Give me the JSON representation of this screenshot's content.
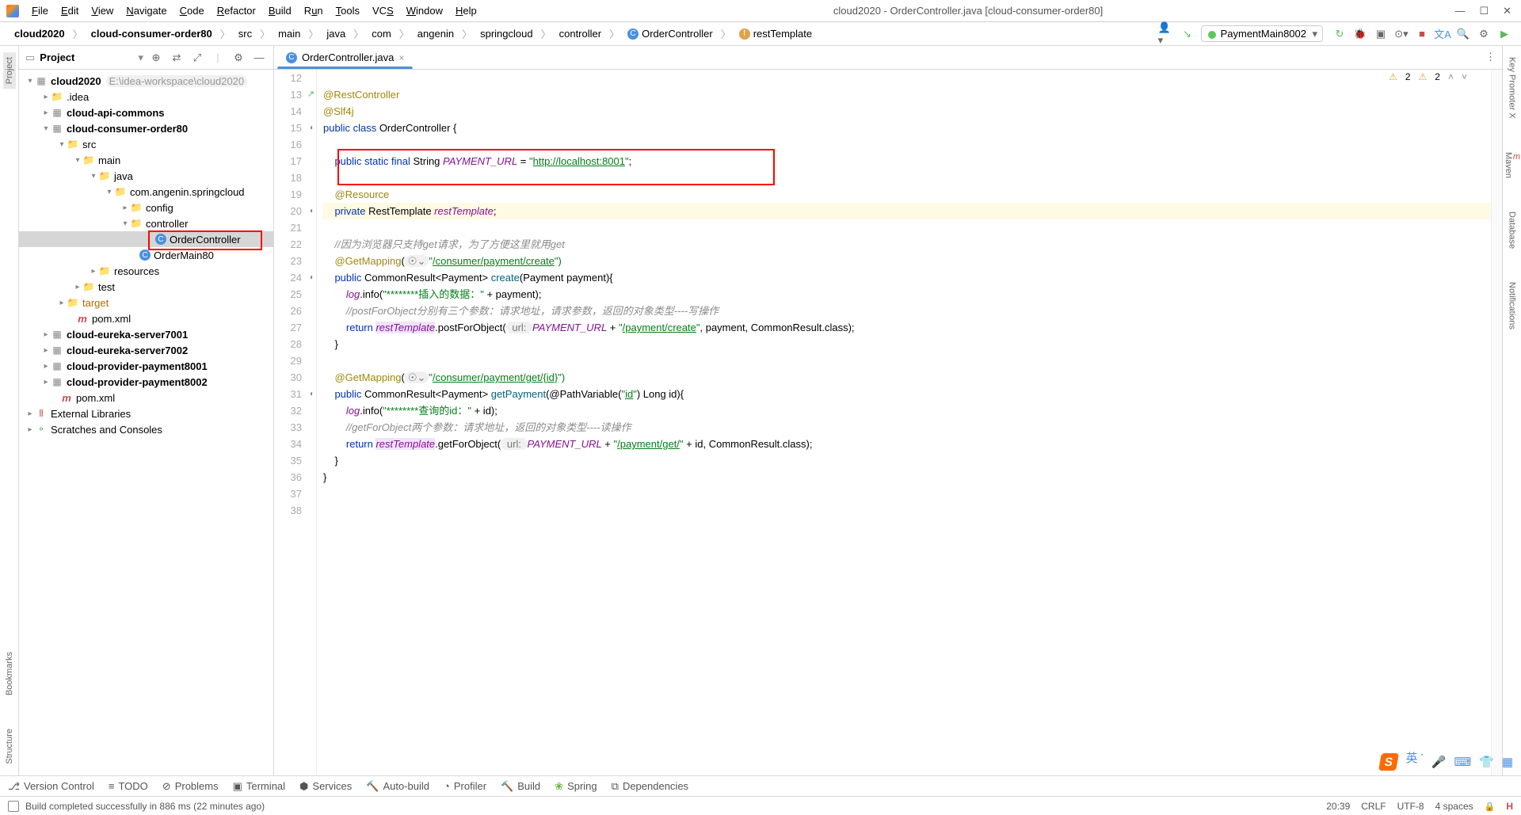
{
  "window": {
    "title": "cloud2020 - OrderController.java [cloud-consumer-order80]"
  },
  "menu": {
    "file": "File",
    "edit": "Edit",
    "view": "View",
    "navigate": "Navigate",
    "code": "Code",
    "refactor": "Refactor",
    "build": "Build",
    "run": "Run",
    "tools": "Tools",
    "vcs": "VCS",
    "window": "Window",
    "help": "Help"
  },
  "breadcrumb": {
    "items": [
      "cloud2020",
      "cloud-consumer-order80",
      "src",
      "main",
      "java",
      "com",
      "angenin",
      "springcloud",
      "controller",
      "OrderController",
      "restTemplate"
    ]
  },
  "runConfig": {
    "name": "PaymentMain8002"
  },
  "leftTabs": {
    "project": "Project",
    "bookmarks": "Bookmarks",
    "structure": "Structure"
  },
  "rightTabs": {
    "keypromoter": "Key Promoter X",
    "maven": "Maven",
    "database": "Database",
    "notifications": "Notifications"
  },
  "projectPanel": {
    "title": "Project",
    "tree": {
      "root": "cloud2020",
      "rootHint": "E:\\idea-workspace\\cloud2020",
      "idea": ".idea",
      "apiCommons": "cloud-api-commons",
      "consumer": "cloud-consumer-order80",
      "src": "src",
      "main": "main",
      "java": "java",
      "pkg": "com.angenin.springcloud",
      "config": "config",
      "controller": "controller",
      "orderController": "OrderController",
      "orderMain": "OrderMain80",
      "resources": "resources",
      "test": "test",
      "target": "target",
      "pom": "pom.xml",
      "eureka1": "cloud-eureka-server7001",
      "eureka2": "cloud-eureka-server7002",
      "payment1": "cloud-provider-payment8001",
      "payment2": "cloud-provider-payment8002",
      "pomRoot": "pom.xml",
      "extLibs": "External Libraries",
      "scratches": "Scratches and Consoles"
    }
  },
  "editor": {
    "tabName": "OrderController.java",
    "warnings": {
      "error": "2",
      "warn": "2"
    },
    "lines": {
      "l12": "",
      "l13": "@RestController",
      "l14": "@Slf4j",
      "l15a": "public class ",
      "l15b": "OrderController {",
      "l16": "",
      "l17a": "    public static final ",
      "l17b": "String ",
      "l17c": "PAYMENT_URL",
      "l17d": " = ",
      "l17e": "\"",
      "l17f": "http://localhost:8001",
      "l17g": "\"",
      "l17h": ";",
      "l18": "",
      "l19": "    @Resource",
      "l20a": "    private ",
      "l20b": "RestTemplate ",
      "l20c": "restTemplate",
      "l20d": ";",
      "l21": "",
      "l22": "    //因为浏览器只支持get请求，为了方便这里就用get",
      "l23a": "    @GetMapping",
      "l23b": "(",
      "l23h": "\"",
      "l23c": "/consumer/payment/create",
      "l23d": "\")",
      "l24a": "    public ",
      "l24b": "CommonResult<Payment> ",
      "l24c": "create",
      "l24d": "(Payment payment){",
      "l25a": "        log",
      "l25b": ".info(",
      "l25c": "\"********插入的数据：\"",
      "l25d": " + payment);",
      "l26": "        //postForObject分别有三个参数：请求地址，请求参数，返回的对象类型----写操作",
      "l27a": "        return ",
      "l27b": "restTemplate",
      "l27c": ".postForObject(",
      "l27h": " url: ",
      "l27d": "PAYMENT_URL",
      "l27e": " + ",
      "l27f": "\"",
      "l27f2": "/payment/create",
      "l27f3": "\"",
      "l27g": ", payment, CommonResult.class);",
      "l28": "    }",
      "l29": "",
      "l30a": "    @GetMapping",
      "l30b": "(",
      "l30h": "\"",
      "l30c": "/consumer/payment/get/{id}",
      "l30d": "\")",
      "l31a": "    public ",
      "l31b": "CommonResult<Payment> ",
      "l31c": "getPayment",
      "l31d": "(@PathVariable(",
      "l31e": "\"",
      "l31e2": "id",
      "l31e3": "\"",
      "l31f": ") Long id){",
      "l32a": "        log",
      "l32b": ".info(",
      "l32c": "\"********查询的id：\"",
      "l32d": " + id);",
      "l33": "        //getForObject两个参数：请求地址，返回的对象类型----读操作",
      "l34a": "        return ",
      "l34b": "restTemplate",
      "l34c": ".getForObject(",
      "l34h": " url: ",
      "l34d": "PAYMENT_URL",
      "l34e": " + ",
      "l34f": "\"",
      "l34f2": "/payment/get/",
      "l34f3": "\"",
      "l34g": " + id, CommonResult.class);",
      "l35": "    }",
      "l36": "}",
      "l37": "",
      "l38": ""
    }
  },
  "bottomTabs": {
    "vcs": "Version Control",
    "todo": "TODO",
    "problems": "Problems",
    "terminal": "Terminal",
    "services": "Services",
    "autobuild": "Auto-build",
    "profiler": "Profiler",
    "build": "Build",
    "spring": "Spring",
    "dependencies": "Dependencies"
  },
  "status": {
    "msg": "Build completed successfully in 886 ms (22 minutes ago)",
    "pos": "20:39",
    "crlf": "CRLF",
    "enc": "UTF-8",
    "indent": "4 spaces"
  }
}
